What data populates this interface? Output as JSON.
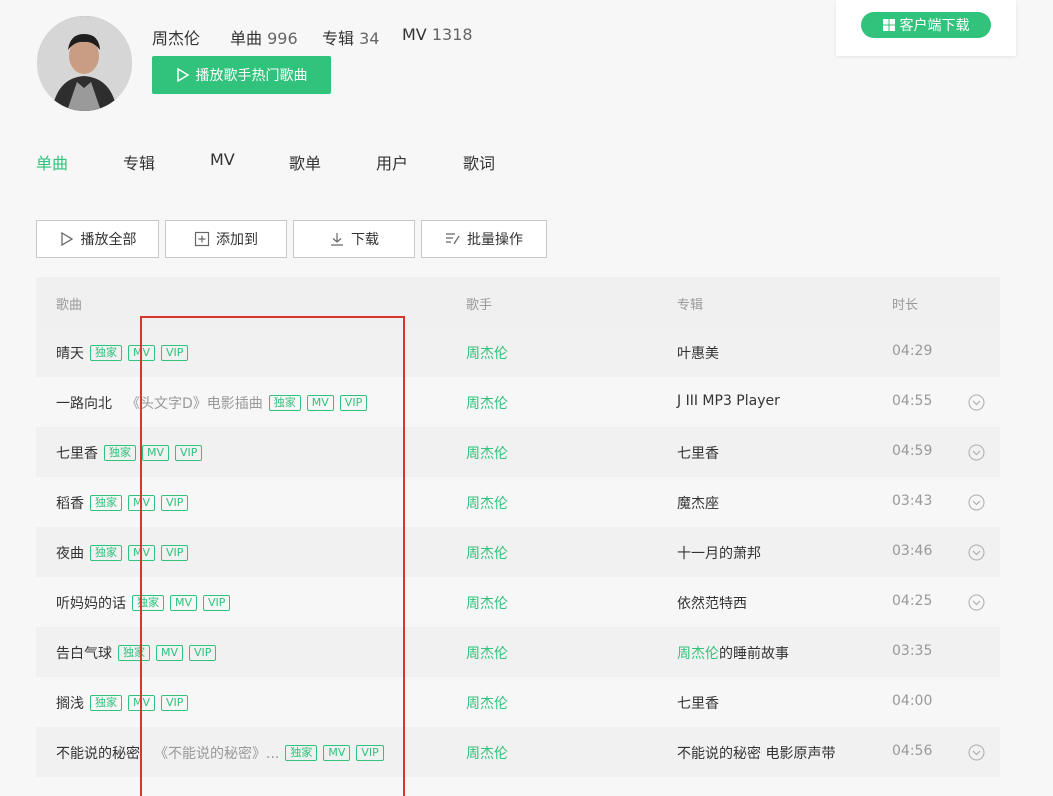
{
  "artist": {
    "name": "周杰伦",
    "single_label": "单曲",
    "single_count": "996",
    "album_label": "专辑",
    "album_count": "34",
    "mv_label": "MV",
    "mv_count": "1318",
    "play_hot_label": "播放歌手热门歌曲"
  },
  "client": {
    "download_label": "客户端下载"
  },
  "tabs": [
    {
      "label": "单曲"
    },
    {
      "label": "专辑"
    },
    {
      "label": "MV"
    },
    {
      "label": "歌单"
    },
    {
      "label": "用户"
    },
    {
      "label": "歌词"
    }
  ],
  "toolbar": {
    "play_all": "播放全部",
    "add_to": "添加到",
    "download": "下载",
    "batch": "批量操作"
  },
  "table": {
    "headers": {
      "song": "歌曲",
      "singer": "歌手",
      "album": "专辑",
      "duration": "时长"
    },
    "tags": {
      "exclusive": "独家",
      "mv": "MV",
      "vip": "VIP"
    },
    "rows": [
      {
        "name": "晴天",
        "sub": "",
        "singer": "周杰伦",
        "album_hl": "",
        "album": "叶惠美",
        "duration": "04:29",
        "more": false
      },
      {
        "name": "一路向北",
        "sub": "《头文字D》电影插曲",
        "singer": "周杰伦",
        "album_hl": "",
        "album": "J III MP3 Player",
        "duration": "04:55",
        "more": true
      },
      {
        "name": "七里香",
        "sub": "",
        "singer": "周杰伦",
        "album_hl": "",
        "album": "七里香",
        "duration": "04:59",
        "more": true
      },
      {
        "name": "稻香",
        "sub": "",
        "singer": "周杰伦",
        "album_hl": "",
        "album": "魔杰座",
        "duration": "03:43",
        "more": true
      },
      {
        "name": "夜曲",
        "sub": "",
        "singer": "周杰伦",
        "album_hl": "",
        "album": "十一月的萧邦",
        "duration": "03:46",
        "more": true
      },
      {
        "name": "听妈妈的话",
        "sub": "",
        "singer": "周杰伦",
        "album_hl": "",
        "album": "依然范特西",
        "duration": "04:25",
        "more": true
      },
      {
        "name": "告白气球",
        "sub": "",
        "singer": "周杰伦",
        "album_hl": "周杰伦",
        "album": "的睡前故事",
        "duration": "03:35",
        "more": false
      },
      {
        "name": "搁浅",
        "sub": "",
        "singer": "周杰伦",
        "album_hl": "",
        "album": "七里香",
        "duration": "04:00",
        "more": false
      },
      {
        "name": "不能说的秘密",
        "sub": "《不能说的秘密》...",
        "singer": "周杰伦",
        "album_hl": "",
        "album": "不能说的秘密 电影原声带",
        "duration": "04:56",
        "more": true
      }
    ]
  },
  "colors": {
    "accent": "#31c27c",
    "highlight_box": "#d9362b"
  }
}
